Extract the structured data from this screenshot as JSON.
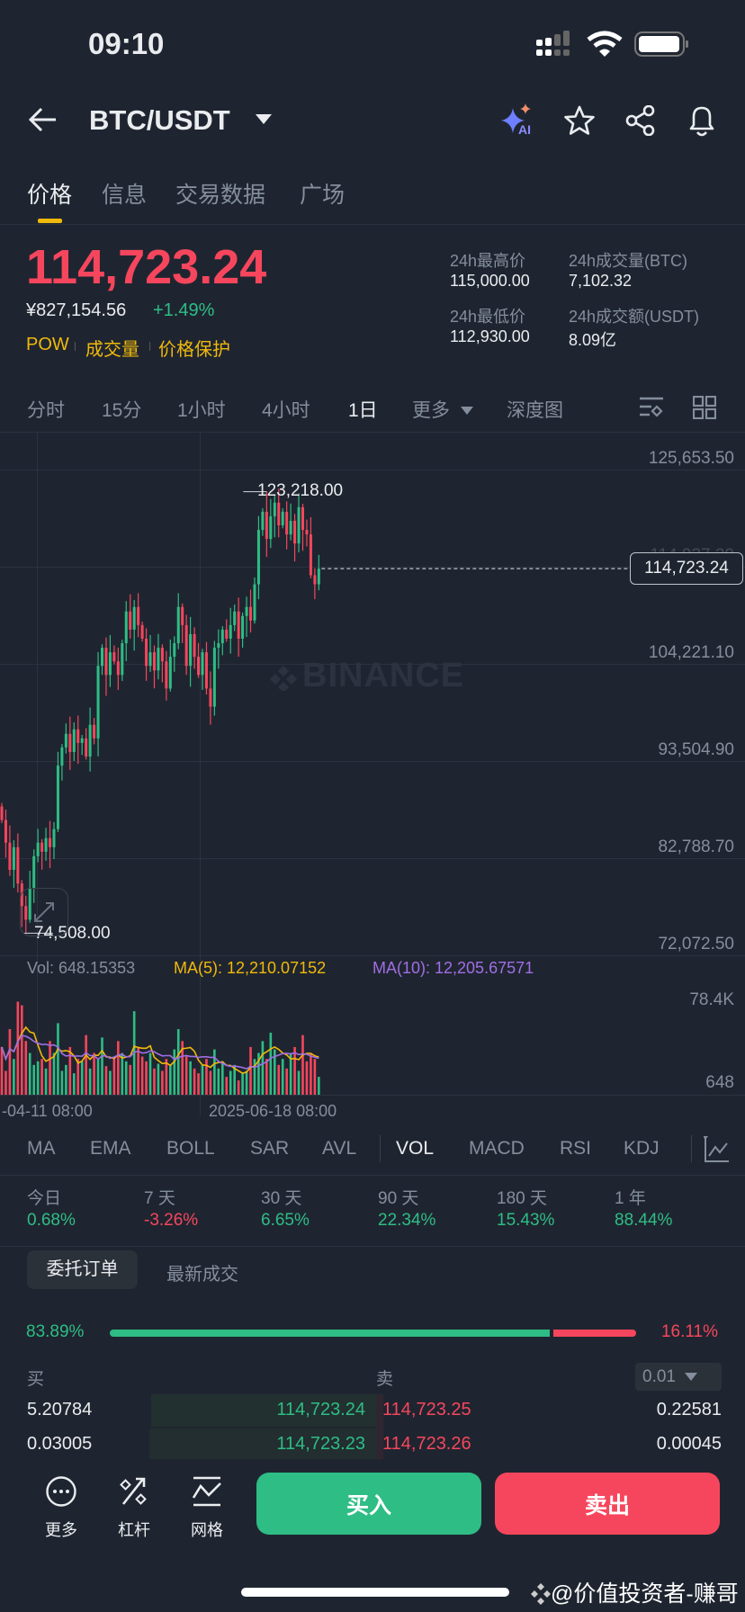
{
  "status_bar": {
    "time": "09:10"
  },
  "header": {
    "pair": "BTC/USDT",
    "ai_label": "AI"
  },
  "tabs": [
    {
      "label": "价格",
      "active": true
    },
    {
      "label": "信息"
    },
    {
      "label": "交易数据"
    },
    {
      "label": "广场"
    }
  ],
  "price": {
    "last": "114,723.24",
    "cny": "¥827,154.56",
    "change": "+1.49%",
    "tags": [
      "POW",
      "成交量",
      "价格保护"
    ]
  },
  "stats": {
    "high_label": "24h最高价",
    "high": "115,000.00",
    "vol_btc_label": "24h成交量(BTC)",
    "vol_btc": "7,102.32",
    "low_label": "24h最低价",
    "low": "112,930.00",
    "vol_usdt_label": "24h成交额(USDT)",
    "vol_usdt": "8.09亿"
  },
  "timeframes": [
    "分时",
    "15分",
    "1小时",
    "4小时",
    "1日",
    "更多",
    "深度图"
  ],
  "active_timeframe": "1日",
  "chart": {
    "y_axis": [
      "125,653.50",
      "114,937.30",
      "104,221.10",
      "93,504.90",
      "82,788.70",
      "72,072.50"
    ],
    "y_axis_values": [
      125653.5,
      114937.3,
      104221.1,
      93504.9,
      82788.7,
      72072.5
    ],
    "max_label": "123,218.00",
    "max_value": 123218,
    "max_index": 66,
    "min_label": "74,508.00",
    "min_value": 74508,
    "min_index": 6,
    "current_label": "114,723.24",
    "current_value": 114723.24,
    "watermark": "BINANCE",
    "closes": [
      87000,
      84500,
      81500,
      84000,
      80000,
      77500,
      76000,
      79500,
      83000,
      84500,
      83500,
      85000,
      84000,
      86000,
      93000,
      95000,
      96500,
      94500,
      97000,
      95500,
      96000,
      94000,
      97500,
      96000,
      104000,
      106000,
      103000,
      105500,
      104500,
      103000,
      106500,
      110000,
      108000,
      110500,
      108500,
      107000,
      104000,
      105500,
      103500,
      106000,
      104500,
      101500,
      105000,
      106500,
      110500,
      108500,
      104000,
      107500,
      105000,
      103000,
      105500,
      101500,
      99500,
      106000,
      106500,
      108000,
      107000,
      108500,
      110000,
      107000,
      109500,
      110500,
      109000,
      113000,
      119000,
      121000,
      118000,
      120500,
      122000,
      119500,
      121000,
      118500,
      120000,
      117500,
      121500,
      119000,
      118500,
      114000,
      113000,
      114723
    ],
    "volume_k": [
      40,
      20,
      55,
      30,
      78,
      75,
      45,
      35,
      25,
      28,
      30,
      22,
      45,
      35,
      60,
      20,
      25,
      40,
      18,
      30,
      28,
      50,
      22,
      35,
      30,
      48,
      24,
      20,
      30,
      45,
      35,
      28,
      25,
      70,
      40,
      32,
      28,
      35,
      22,
      26,
      20,
      30,
      25,
      38,
      55,
      45,
      32,
      28,
      22,
      18,
      25,
      30,
      20,
      38,
      22,
      28,
      15,
      20,
      25,
      12,
      18,
      20,
      40,
      30,
      35,
      45,
      30,
      52,
      38,
      25,
      30,
      22,
      35,
      40,
      20,
      50,
      28,
      35,
      30,
      15
    ],
    "vol_axis": [
      "78.4K",
      "648"
    ],
    "vol_label": "Vol: 648.15353",
    "ma5_label": "MA(5): 12,210.07152",
    "ma10_label": "MA(10): 12,205.67571",
    "dates": [
      "-04-11 08:00",
      "2025-06-18 08:00"
    ]
  },
  "indicators": [
    "MA",
    "EMA",
    "BOLL",
    "SAR",
    "AVL",
    "VOL",
    "MACD",
    "RSI",
    "KDJ"
  ],
  "active_indicator": "VOL",
  "performance": [
    {
      "label": "今日",
      "value": "0.68%",
      "dir": "up"
    },
    {
      "label": "7 天",
      "value": "-3.26%",
      "dir": "down"
    },
    {
      "label": "30 天",
      "value": "6.65%",
      "dir": "up"
    },
    {
      "label": "90 天",
      "value": "22.34%",
      "dir": "up"
    },
    {
      "label": "180 天",
      "value": "15.43%",
      "dir": "up"
    },
    {
      "label": "1 年",
      "value": "88.44%",
      "dir": "up"
    }
  ],
  "book_tabs": [
    "委托订单",
    "最新成交"
  ],
  "book": {
    "buy_ratio": "83.89%",
    "sell_ratio": "16.11%",
    "buy_pct": 83.89,
    "buy_label": "买",
    "sell_label": "卖",
    "precision": "0.01",
    "rows": [
      {
        "bid_qty": "5.20784",
        "bid": "114,723.24",
        "ask": "114,723.25",
        "ask_qty": "0.22581"
      },
      {
        "bid_qty": "0.03005",
        "bid": "114,723.23",
        "ask": "114,723.26",
        "ask_qty": "0.00045"
      }
    ]
  },
  "bottom": {
    "more": "更多",
    "leverage": "杠杆",
    "grid": "网格",
    "buy": "买入",
    "sell": "卖出"
  },
  "watermark": "@价值投资者-赚哥",
  "colors": {
    "up": "#2ebd85",
    "down": "#f6465d",
    "accent": "#f0b90b",
    "ma10": "#a06ee4"
  }
}
